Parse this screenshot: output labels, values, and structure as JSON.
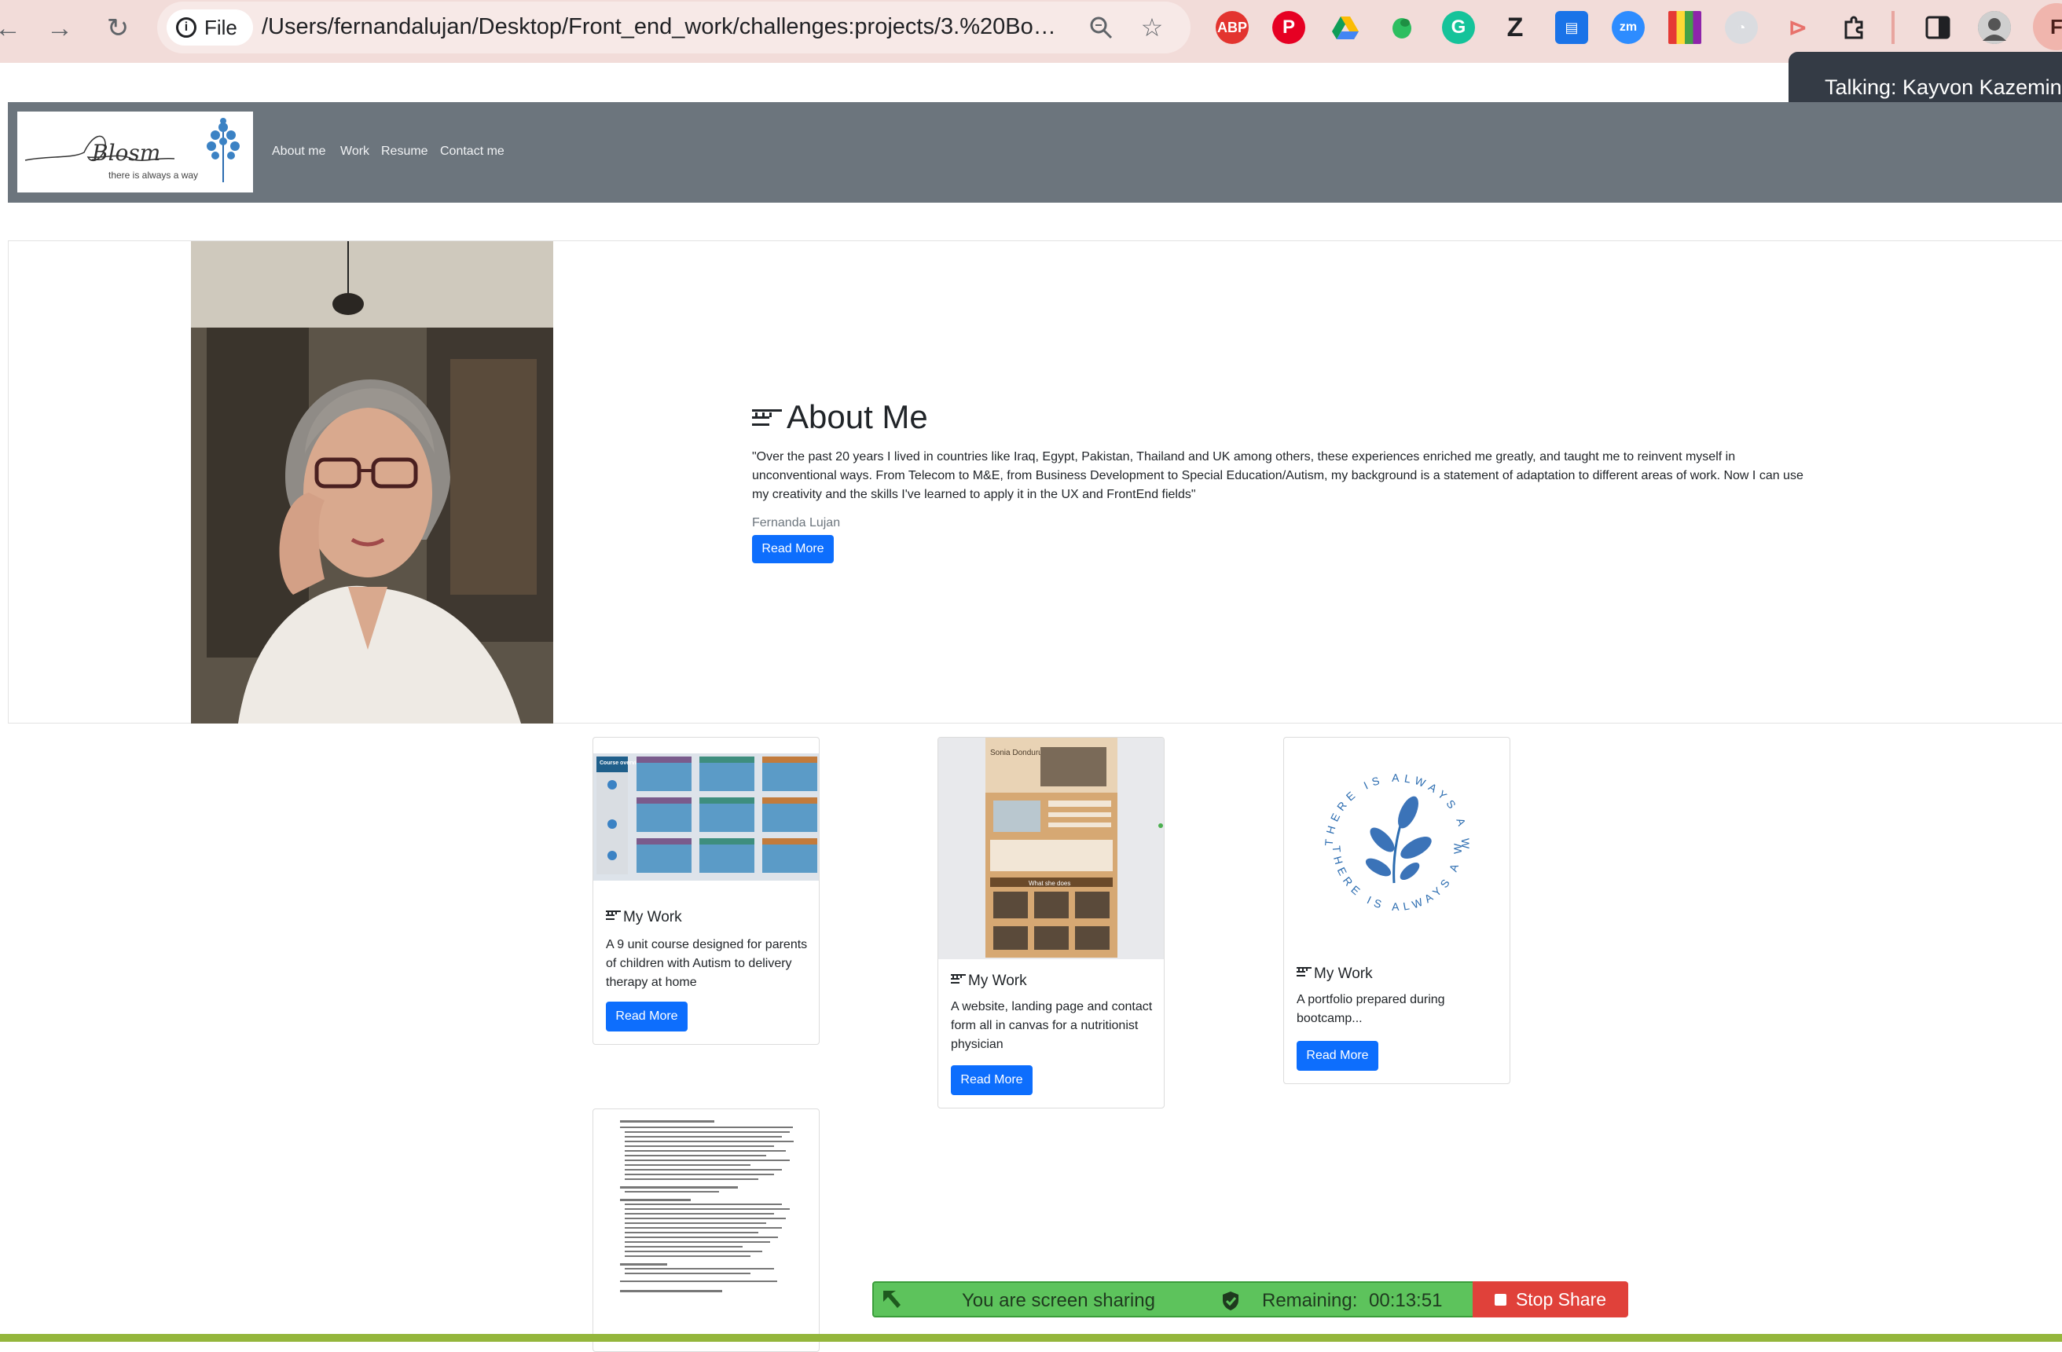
{
  "browser": {
    "scheme_label": "File",
    "url": "/Users/fernandalujan/Desktop/Front_end_work/challenges:projects/3.%20Bo…",
    "extensions": [
      "adblock-icon",
      "pinterest-icon",
      "google-drive-icon",
      "evernote-icon",
      "grammarly-icon",
      "zotero-icon",
      "reader-icon",
      "zoom-icon",
      "color-palette-icon",
      "loading-icon",
      "screencast-icon",
      "puzzle-extensions-icon",
      "side-panel-icon",
      "profile-avatar"
    ],
    "profile_initial": "F"
  },
  "notification": {
    "talking_text": "Talking: Kayvon Kazemini"
  },
  "site_nav": {
    "logo_script": "Blosm",
    "logo_tagline": "there is always a way",
    "links": [
      "About me",
      "Work",
      "Resume",
      "Contact me"
    ]
  },
  "about": {
    "icon": "lines-icon",
    "title": "About Me",
    "quote": "\"Over the past 20 years I lived in countries like Iraq, Egypt, Pakistan, Thailand and UK among others, these experiences enriched me greatly, and taught me to reinvent myself in unconventional ways. From Telecom to M&E, from Business Development to Special Education/Autism, my background is a statement of adaptation to different areas of work. Now I can use my creativity and the skills I've learned to apply it in the UX and FrontEnd fields\"",
    "author": "Fernanda Lujan",
    "button": "Read More"
  },
  "cards": [
    {
      "title": "My Work",
      "text": "A 9 unit course designed for parents of children with Autism to delivery therapy at home",
      "button": "Read More",
      "image_caption": "Course overview"
    },
    {
      "title": "My Work",
      "text": "A website, landing page and contact form all in canvas for a nutritionist physician",
      "button": "Read More",
      "image_caption": "Sonia Donduru",
      "image_subcaption": "What she does"
    },
    {
      "title": "My Work",
      "text": "A portfolio prepared during bootcamp...",
      "button": "Read More",
      "image_caption": "THERE IS ALWAYS A WAY"
    }
  ],
  "screen_share": {
    "status": "You are screen sharing",
    "remaining_label": "Remaining:",
    "remaining_time": "00:13:51",
    "stop_button": "Stop Share"
  }
}
